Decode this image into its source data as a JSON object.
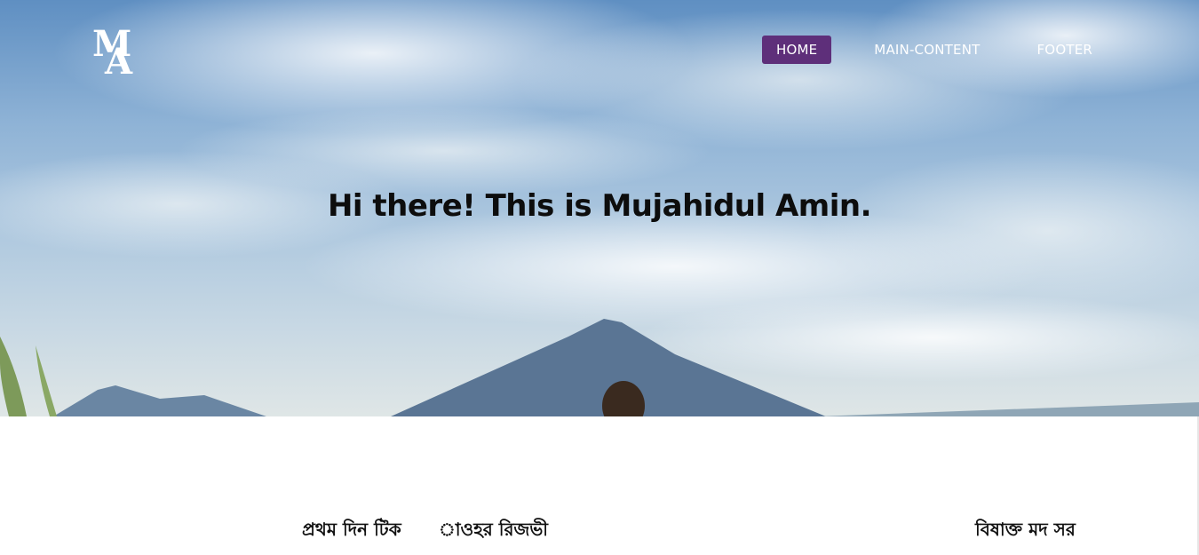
{
  "logo": {
    "top_letters": "M",
    "bottom_letters": "A"
  },
  "nav": {
    "items": [
      {
        "label": "HOME",
        "active": true
      },
      {
        "label": "MAIN-CONTENT",
        "active": false
      },
      {
        "label": "FOOTER",
        "active": false
      }
    ]
  },
  "hero": {
    "title": "Hi there! This is Mujahidul Amin."
  },
  "content": {
    "snippets": [
      "প্রথম দিন টিক",
      "াওহর রিজভী",
      "বিষাক্ত মদ সর"
    ]
  },
  "colors": {
    "nav_active_bg": "#5e2f7a",
    "hero_title": "#0d0d0d"
  }
}
